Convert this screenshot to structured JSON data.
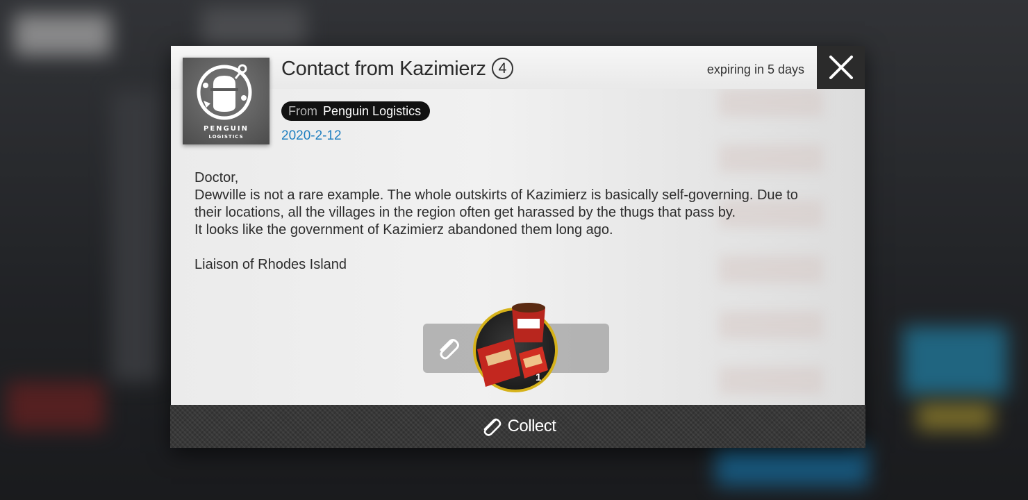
{
  "mail": {
    "title": "Contact from Kazimierz",
    "title_number": "4",
    "expiry": "expiring in 5 days",
    "from_label": "From",
    "sender": "Penguin Logistics",
    "date": "2020-2-12",
    "body": {
      "line1": "Doctor,",
      "line2": "Dewville is not a rare example. The whole outskirts of Kazimierz is basically self-governing. Due to their locations, all the villages in the region often get harassed by the thugs that pass by.",
      "line3": "It looks like the government of Kazimierz abandoned them long ago.",
      "signature": "Liaison of Rhodes Island"
    }
  },
  "logo": {
    "word1": "PENGUIN",
    "word2": "LOGISTICS"
  },
  "attachment": {
    "icon": "paperclip-icon",
    "item_icon": "food-pack-icon",
    "quantity": "1",
    "ring_color": "#d6b21a"
  },
  "actions": {
    "collect_label": "Collect",
    "close_icon": "close-icon"
  },
  "colors": {
    "date": "#1f7fc0",
    "close_bg": "#2b2b2b"
  }
}
